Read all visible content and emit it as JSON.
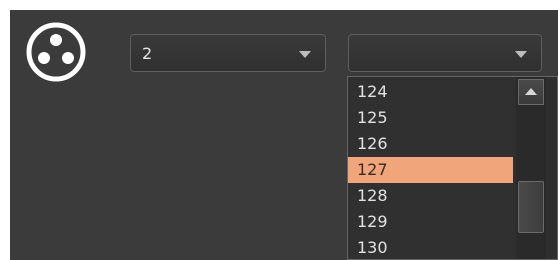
{
  "left_combo": {
    "value": "2"
  },
  "right_combo": {
    "value": ""
  },
  "dropdown": {
    "options": [
      "124",
      "125",
      "126",
      "127",
      "128",
      "129",
      "130"
    ],
    "selected": "127"
  },
  "colors": {
    "panel_background": "#3b3b3b",
    "highlight": "#f0a57a",
    "text": "#e2e2e2"
  },
  "icons": {
    "connector": "dmx-connector-icon",
    "combo_caret": "chevron-down-icon",
    "scroll_up": "scroll-up-arrow-icon"
  }
}
